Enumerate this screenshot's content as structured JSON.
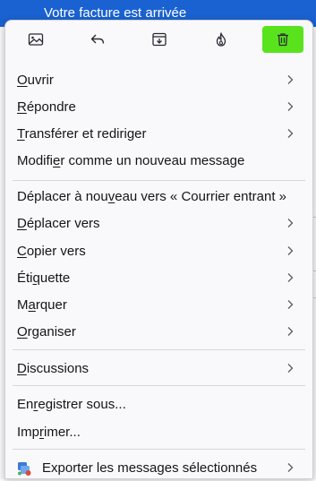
{
  "background": {
    "header_text": "Votre facture est arrivée"
  },
  "toolbar": {
    "buttons": [
      {
        "name": "image-message-icon"
      },
      {
        "name": "reply-icon"
      },
      {
        "name": "archive-icon"
      },
      {
        "name": "junk-fire-icon"
      },
      {
        "name": "delete-trash-icon",
        "active": true
      }
    ],
    "active_color": "#58e31c"
  },
  "menu": {
    "open": {
      "pre": "",
      "u": "O",
      "post": "uvrir"
    },
    "reply": {
      "pre": "",
      "u": "R",
      "post": "épondre"
    },
    "forward": {
      "pre": "",
      "u": "T",
      "post": "ransférer et rediriger"
    },
    "edit_new": {
      "pre": "Modifi",
      "u": "e",
      "post": "r comme un nouveau message"
    },
    "move_again": {
      "pre": "Déplacer à nou",
      "u": "v",
      "post": "eau vers « Courrier entrant »"
    },
    "move_to": {
      "pre": "",
      "u": "D",
      "post": "éplacer vers"
    },
    "copy_to": {
      "pre": "",
      "u": "C",
      "post": "opier vers"
    },
    "tag": {
      "pre": "Éti",
      "u": "q",
      "post": "uette"
    },
    "mark": {
      "pre": "M",
      "u": "a",
      "post": "rquer"
    },
    "organize": {
      "pre": "",
      "u": "O",
      "post": "rganiser"
    },
    "threads": {
      "pre": "",
      "u": "D",
      "post": "iscussions"
    },
    "save_as": {
      "pre": "En",
      "u": "r",
      "post": "egistrer sous..."
    },
    "print": {
      "pre": "Imp",
      "u": "r",
      "post": "imer..."
    },
    "export": {
      "label": "Exporter les messages sélectionnés"
    }
  }
}
